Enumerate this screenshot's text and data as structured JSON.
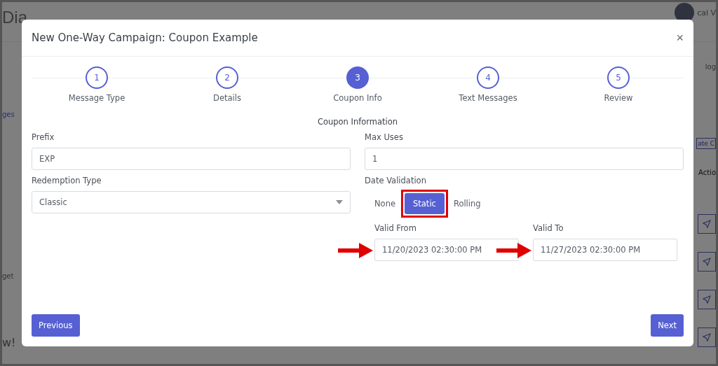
{
  "background": {
    "app_title": "Dia",
    "user_name": "cal V",
    "sidebar_items": [
      "ges",
      "get"
    ],
    "welcome": "w!",
    "right_items": [
      "log",
      "ate C",
      "Actio"
    ]
  },
  "modal": {
    "title": "New One-Way Campaign: Coupon Example",
    "close": "×",
    "steps": [
      {
        "number": "1",
        "label": "Message Type",
        "selected": false
      },
      {
        "number": "2",
        "label": "Details",
        "selected": false
      },
      {
        "number": "3",
        "label": "Coupon Info",
        "selected": true
      },
      {
        "number": "4",
        "label": "Text Messages",
        "selected": false
      },
      {
        "number": "5",
        "label": "Review",
        "selected": false
      }
    ],
    "section_title": "Coupon Information",
    "prefix": {
      "label": "Prefix",
      "value": "EXP"
    },
    "max_uses": {
      "label": "Max Uses",
      "value": "1"
    },
    "redemption_type": {
      "label": "Redemption Type",
      "value": "Classic"
    },
    "date_validation": {
      "label": "Date Validation",
      "options": [
        {
          "label": "None",
          "selected": false
        },
        {
          "label": "Static",
          "selected": true
        },
        {
          "label": "Rolling",
          "selected": false
        }
      ]
    },
    "valid_from": {
      "label": "Valid From",
      "value": "11/20/2023 02:30:00 PM"
    },
    "valid_to": {
      "label": "Valid To",
      "value": "11/27/2023 02:30:00 PM"
    },
    "buttons": {
      "previous": "Previous",
      "next": "Next"
    }
  }
}
